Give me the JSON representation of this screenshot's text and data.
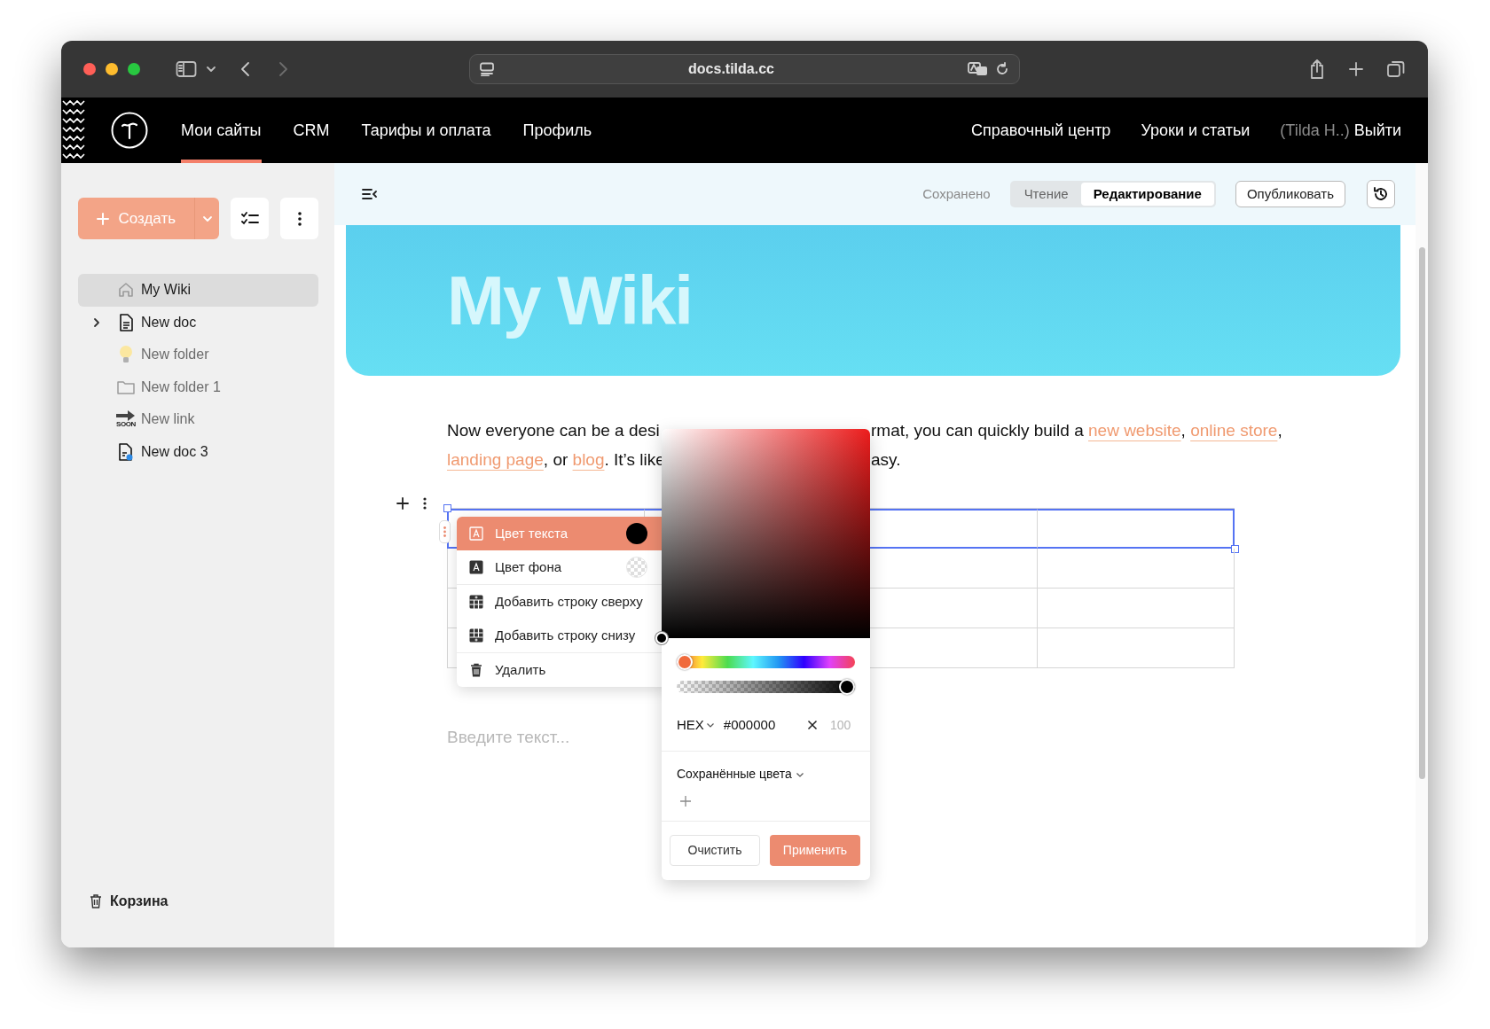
{
  "browser": {
    "url": "docs.tilda.cc"
  },
  "nav": {
    "items": [
      {
        "label": "Мои сайты",
        "selected": true
      },
      {
        "label": "CRM",
        "selected": false
      },
      {
        "label": "Тарифы и оплата",
        "selected": false
      },
      {
        "label": "Профиль",
        "selected": false
      }
    ],
    "links": [
      "Справочный центр",
      "Уроки и статьи"
    ],
    "user": "(Tilda H..)",
    "logout": "Выйти"
  },
  "sidebar": {
    "create_button": "Создать",
    "tree": [
      {
        "label": "My Wiki",
        "kind": "home",
        "selected": true,
        "expandable": false,
        "dimmed": false
      },
      {
        "label": "New doc",
        "kind": "doc",
        "selected": false,
        "expandable": true,
        "dimmed": false
      },
      {
        "label": "New folder",
        "kind": "bulb",
        "selected": false,
        "expandable": false,
        "dimmed": true
      },
      {
        "label": "New folder 1",
        "kind": "folder",
        "selected": false,
        "expandable": false,
        "dimmed": true
      },
      {
        "label": "New link",
        "kind": "link",
        "badge": "SOON",
        "selected": false,
        "expandable": false,
        "dimmed": true
      },
      {
        "label": "New doc 3",
        "kind": "doc-dot",
        "selected": false,
        "expandable": false,
        "dimmed": false
      }
    ],
    "trash": "Корзина"
  },
  "toolbar": {
    "status": "Сохранено",
    "modes": [
      {
        "label": "Чтение",
        "selected": false
      },
      {
        "label": "Редактирование",
        "selected": true
      }
    ],
    "publish": "Опубликовать"
  },
  "hero": {
    "title": "My Wiki"
  },
  "paragraph": {
    "lines": [
      {
        "before": [
          {
            "text": "Now everyone can be a desi",
            "link": false
          }
        ],
        "after": [
          {
            "text": "rmat, you can quickly build a ",
            "link": false
          },
          {
            "text": "new website",
            "link": true
          },
          {
            "text": ", ",
            "link": false
          },
          {
            "text": "online store",
            "link": true
          },
          {
            "text": ",",
            "link": false
          }
        ]
      },
      {
        "before": [
          {
            "text": "landing page",
            "link": true
          },
          {
            "text": ", or ",
            "link": false
          },
          {
            "text": "blog",
            "link": true
          },
          {
            "text": ". It’s like",
            "link": false
          }
        ],
        "after": [
          {
            "text": "asy.",
            "link": false
          }
        ]
      }
    ]
  },
  "table": {
    "rows": [
      {
        "selected": true
      },
      {
        "selected": false
      },
      {
        "selected": false
      },
      {
        "selected": false
      }
    ]
  },
  "placeholder": "Введите текст...",
  "context_menu": {
    "sections": [
      [
        {
          "label": "Цвет текста",
          "kind": "text-color",
          "swatch": {
            "kind": "solid",
            "color": "#000000"
          },
          "selected": true
        },
        {
          "label": "Цвет фона",
          "kind": "bg-color",
          "swatch": {
            "kind": "transparent"
          },
          "selected": false
        }
      ],
      [
        {
          "label": "Добавить строку сверху",
          "kind": "row-above",
          "selected": false
        },
        {
          "label": "Добавить строку снизу",
          "kind": "row-below",
          "selected": false
        }
      ],
      [
        {
          "label": "Удалить",
          "kind": "trash",
          "selected": false
        }
      ]
    ]
  },
  "color_picker": {
    "format": "HEX",
    "value": "#000000",
    "opacity_placeholder": "100",
    "hue": {
      "level": 0
    },
    "alpha": {
      "level": 1
    },
    "saved_colors": {
      "title": "Сохранённые цвета"
    },
    "buttons": {
      "clear": "Очистить",
      "apply": "Применить"
    }
  }
}
